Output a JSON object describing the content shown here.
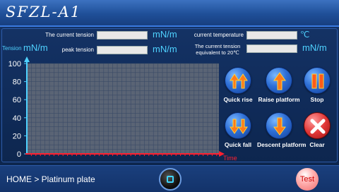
{
  "header": {
    "title": "SFZL-A1"
  },
  "readouts": {
    "current_tension": {
      "label": "The current tension",
      "value": "",
      "unit": "mN/m"
    },
    "peak_tension": {
      "label": "peak tension",
      "value": "",
      "unit": "mN/m"
    },
    "current_temperature": {
      "label": "current temperature",
      "value": "",
      "unit": "℃"
    },
    "tension_20c": {
      "label_line1": "The current tension",
      "label_line2": "equivalent to 20℃",
      "value": "",
      "unit": "mN/m"
    }
  },
  "chart_data": {
    "type": "line",
    "ylabel": "Tension",
    "yunit": "mN/m",
    "xlabel": "Time",
    "ylim": [
      0,
      100
    ],
    "yticks": [
      "100",
      "80",
      "60",
      "40",
      "20",
      "0"
    ],
    "grid": true,
    "series": []
  },
  "controls": [
    {
      "id": "quick-rise",
      "label": "Quick rise",
      "icon": "double-arrow-up-icon"
    },
    {
      "id": "raise-platform",
      "label": "Raise platform",
      "icon": "arrow-up-icon"
    },
    {
      "id": "stop",
      "label": "Stop",
      "icon": "pause-icon"
    },
    {
      "id": "quick-fall",
      "label": "Quick fall",
      "icon": "double-arrow-down-icon"
    },
    {
      "id": "descent-platform",
      "label": "Descent platform",
      "icon": "arrow-down-icon"
    },
    {
      "id": "clear",
      "label": "Clear",
      "icon": "x-icon"
    }
  ],
  "footer": {
    "breadcrumb": "HOME > Platinum plate",
    "test_label": "Test"
  },
  "colors": {
    "accent": "#4fd2ff",
    "axis": "#4fd2ff",
    "time_axis": "#ff2030",
    "grid": "#3a4a66"
  }
}
